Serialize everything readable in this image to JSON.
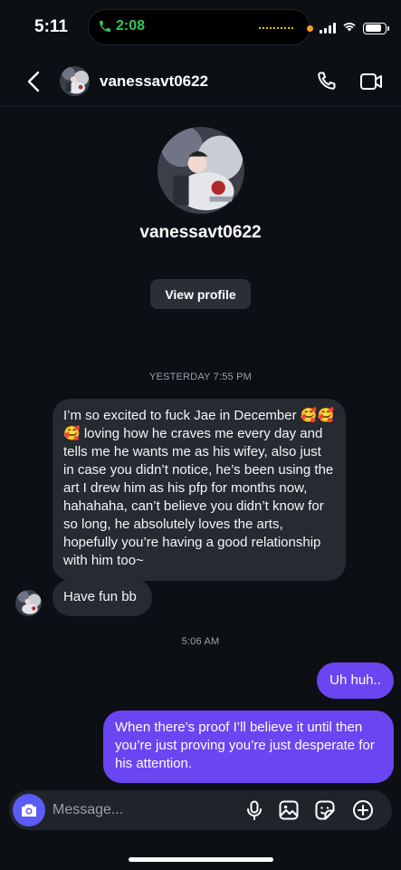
{
  "status_bar": {
    "time": "5:11",
    "call_time": "2:08",
    "signal_icon": "cellular-signal-icon",
    "wifi_icon": "wifi-icon",
    "battery_icon": "battery-icon"
  },
  "header": {
    "back_icon": "chevron-left-icon",
    "username": "vanessavt0622",
    "call_icon": "phone-icon",
    "video_icon": "video-camera-icon"
  },
  "profile": {
    "username": "vanessavt0622",
    "view_profile_label": "View profile"
  },
  "thread": {
    "timestamp_1": "YESTERDAY 7:55 PM",
    "message_1": "I’m so excited to fuck Jae in December 🥰🥰🥰 loving how he craves me every day and tells me he wants me as his wifey, also just in case you didn’t notice, he’s been using the art I drew him as his pfp for months now, hahahaha, can’t believe you didn’t know for so long, he absolutely loves the arts, hopefully you’re having a good relationship with him too~",
    "message_2": "Have fun bb",
    "timestamp_2": "5:06 AM",
    "message_3": "Uh huh..",
    "message_4": "When there’s proof I’ll believe it until then you’re just proving you’re just desperate for his attention."
  },
  "composer": {
    "placeholder": "Message...",
    "camera_icon": "camera-icon",
    "mic_icon": "microphone-icon",
    "gallery_icon": "image-gallery-icon",
    "sticker_icon": "sticker-icon",
    "plus_icon": "plus-circle-icon"
  },
  "colors": {
    "background": "#0c1014",
    "incoming_bubble": "#262a31",
    "outgoing_bubble": "#6b45f1",
    "camera_button": "#5b5bf5",
    "call_green": "#34c759"
  }
}
